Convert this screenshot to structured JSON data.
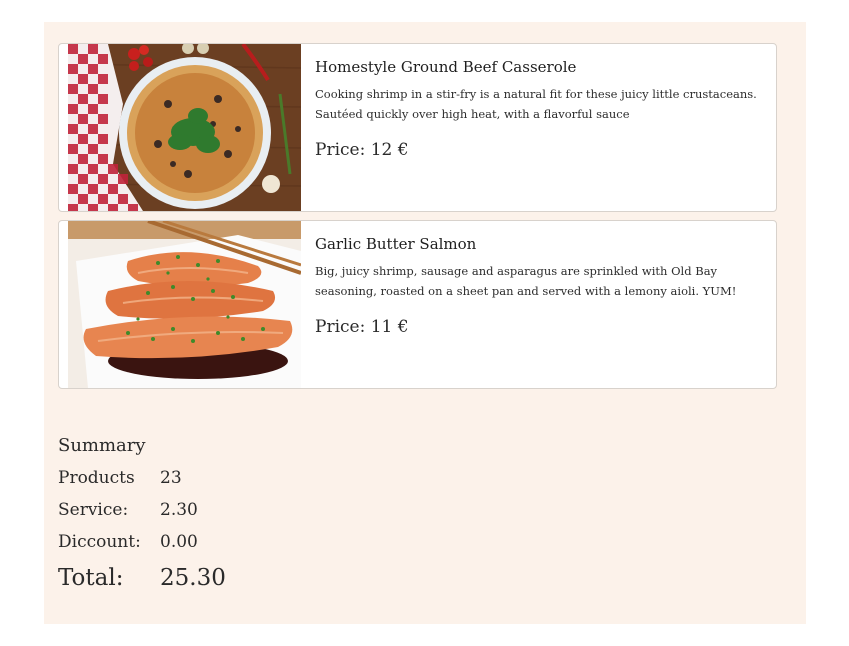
{
  "products": [
    {
      "title": "Homestyle Ground Beef Casserole",
      "description": "Cooking shrimp in a stir-fry is a natural fit for these juicy little crustaceans. Sautéed quickly over high heat, with a flavorful sauce",
      "price": "Price: 12 €",
      "image": "pizza-image"
    },
    {
      "title": "Garlic Butter Salmon",
      "description": "Big, juicy shrimp, sausage and asparagus are sprinkled with Old Bay seasoning, roasted on a sheet pan and served with a lemony aioli. YUM!",
      "price": "Price: 11 €",
      "image": "salmon-image"
    }
  ],
  "summary": {
    "title": "Summary",
    "products_label": "Products",
    "products_value": "23",
    "service_label": "Service:",
    "service_value": "2.30",
    "discount_label": "Diccount:",
    "discount_value": "0.00",
    "total_label": "Total:",
    "total_value": "25.30"
  },
  "colors": {
    "panel_background": "#fcf2ea",
    "card_background": "#ffffff",
    "card_border": "#d8d2cc"
  }
}
